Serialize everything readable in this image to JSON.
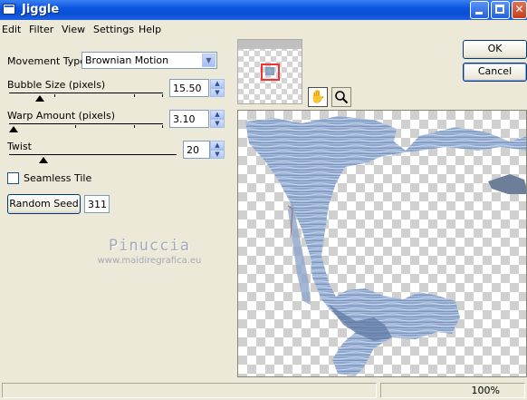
{
  "window": {
    "title": "Jiggle"
  },
  "menu": [
    "Edit",
    "Filter",
    "View",
    "Settings",
    "Help"
  ],
  "controls": {
    "movement_type": {
      "label": "Movement Type:",
      "value": "Brownian Motion"
    },
    "bubble_size": {
      "label": "Bubble Size (pixels)",
      "value": "15.50"
    },
    "warp_amount": {
      "label": "Warp Amount (pixels)",
      "value": "3.10"
    },
    "twist": {
      "label": "Twist",
      "value": "20"
    },
    "seamless_tile": {
      "label": "Seamless Tile",
      "checked": false
    },
    "random_seed": {
      "label": "Random Seed",
      "value": "311"
    }
  },
  "buttons": {
    "ok": "OK",
    "cancel": "Cancel"
  },
  "watermark": {
    "name": "Pinuccia",
    "url": "www.maidiregrafica.eu"
  },
  "status": {
    "zoom": "100%"
  },
  "icons": {
    "pan": "hand-icon",
    "zoom": "magnifier-icon"
  }
}
